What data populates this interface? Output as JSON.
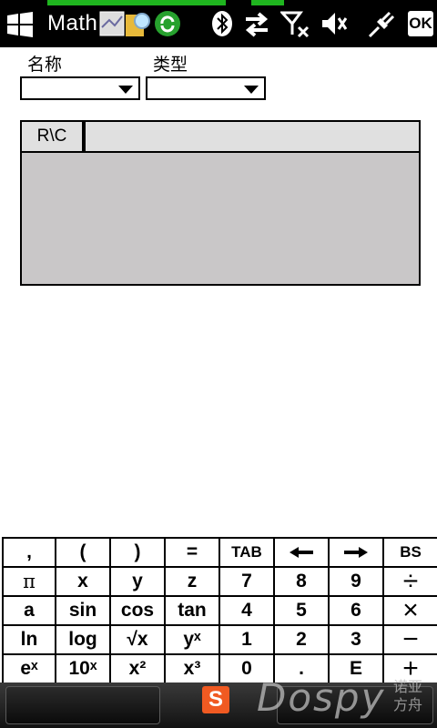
{
  "statusbar": {
    "app_title": "Math",
    "ok_label": "OK",
    "icons": [
      "windows-start-icon",
      "app-thumb-icon",
      "search-icon",
      "sync-icon",
      "bluetooth-icon",
      "data-transfer-icon",
      "signal-off-icon",
      "volume-muted-icon",
      "power-plug-icon"
    ]
  },
  "form": {
    "name_label": "名称",
    "type_label": "类型",
    "name_value": "",
    "type_value": ""
  },
  "grid": {
    "corner_label": "R\\C"
  },
  "keyboard": {
    "rows": [
      [
        ",",
        "(",
        ")",
        "=",
        "TAB",
        "arrow-left-icon",
        "arrow-right-icon",
        "BS"
      ],
      [
        "π",
        "x",
        "y",
        "z",
        "7",
        "8",
        "9",
        "÷"
      ],
      [
        "a",
        "sin",
        "cos",
        "tan",
        "4",
        "5",
        "6",
        "×"
      ],
      [
        "ln",
        "log",
        "√x",
        "yˣ",
        "1",
        "2",
        "3",
        "−"
      ],
      [
        "eˣ",
        "10ˣ",
        "x²",
        "x³",
        "0",
        ".",
        "E",
        "+"
      ]
    ]
  },
  "bottom": {
    "ime_label": "S",
    "watermark_text": "Dospy",
    "watermark_sub": "诺亚方舟"
  }
}
